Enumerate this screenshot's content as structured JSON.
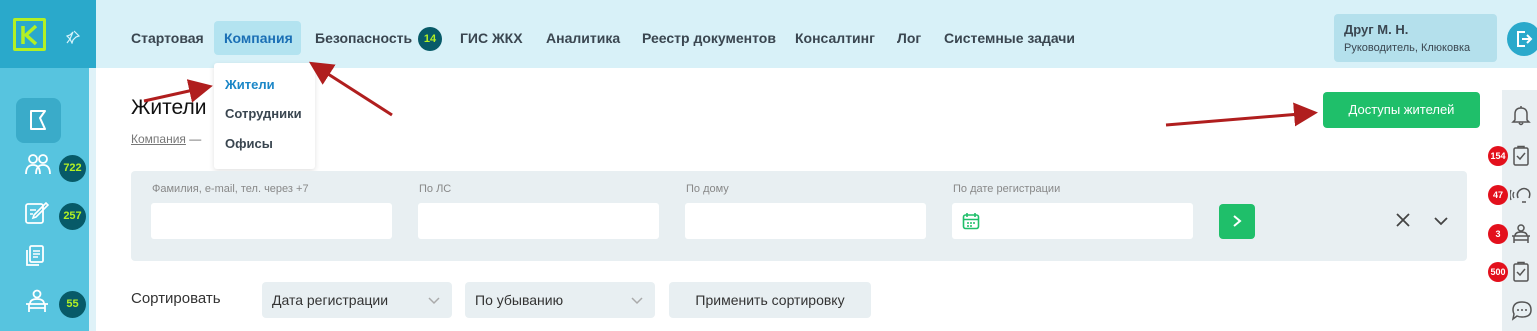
{
  "nav": {
    "items": [
      "Стартовая",
      "Компания",
      "Безопасность",
      "ГИС ЖКХ",
      "Аналитика",
      "Реестр документов",
      "Консалтинг",
      "Лог",
      "Системные задачи"
    ],
    "active": "Компания",
    "security_badge": "14"
  },
  "user": {
    "name": "Друг М. Н.",
    "role": "Руководитель, Клюковка"
  },
  "dropdown": {
    "items": [
      "Жители",
      "Сотрудники",
      "Офисы"
    ],
    "active": "Жители"
  },
  "sidebar": {
    "badges": [
      "722",
      "257",
      "55"
    ],
    "icons": [
      "logo-icon",
      "pin-icon",
      "home-icon",
      "residents-icon",
      "requests-icon",
      "documents-icon",
      "desk-icon"
    ]
  },
  "page": {
    "title": "Жители",
    "breadcrumb_link": "Компания",
    "breadcrumb_sep": "—",
    "access_button": "Доступы жителей"
  },
  "filters": {
    "name_label": "Фамилия, e-mail, тел. через +7",
    "ls_label": "По ЛС",
    "house_label": "По дому",
    "date_label": "По дате регистрации"
  },
  "sort": {
    "label": "Сортировать",
    "field": "Дата регистрации",
    "order": "По убыванию",
    "apply": "Применить сортировку"
  },
  "rightbar": {
    "badges": [
      "154",
      "47",
      "3",
      "500"
    ],
    "icons": [
      "bell-icon",
      "tasks-icon",
      "support-icon",
      "desk-icon",
      "checklist-icon",
      "chat-icon"
    ]
  },
  "colors": {
    "sidebar": "#57c4df",
    "topbar": "#d8f1f8",
    "accent_green": "#1fbf6a",
    "badge_dark": "#075a68",
    "badge_red": "#e3101c",
    "logo_lime": "#b3f023",
    "annotation_arrow": "#b01e1e"
  }
}
